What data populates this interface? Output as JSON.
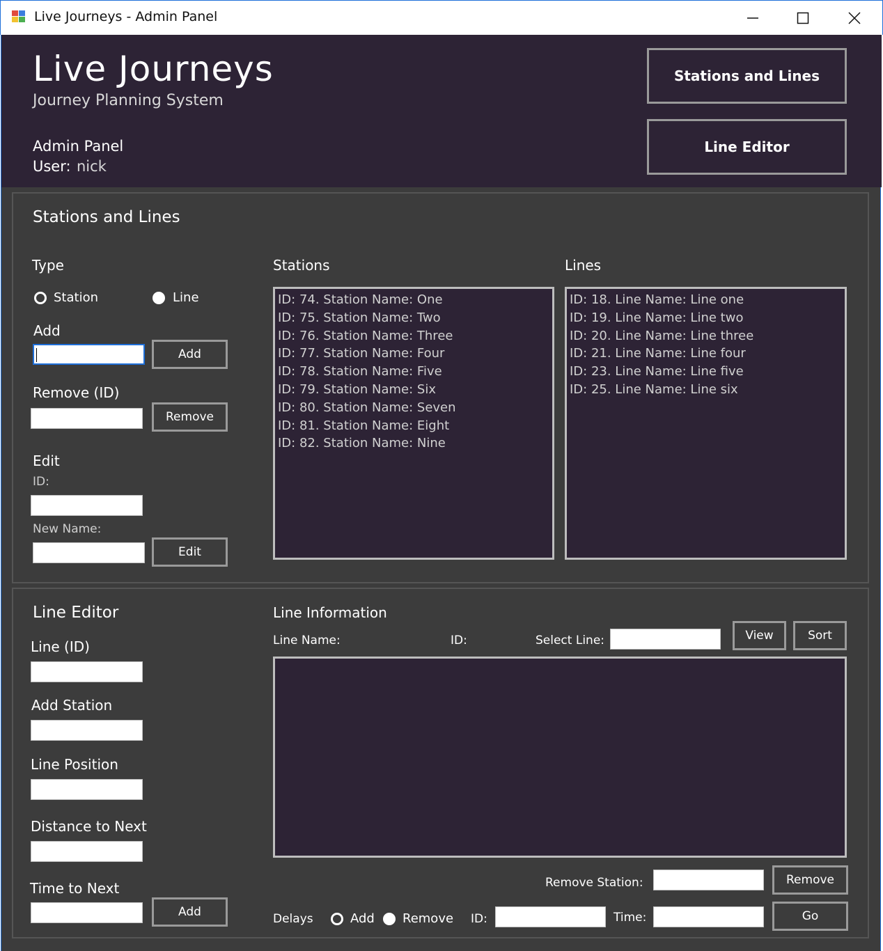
{
  "window": {
    "title": "Live Journeys - Admin Panel",
    "controls": [
      "minimize",
      "maximize",
      "close"
    ]
  },
  "header": {
    "title": "Live Journeys",
    "subtitle": "Journey Planning System",
    "admin_label": "Admin Panel",
    "user_label": "User:",
    "user_name": "nick",
    "nav": {
      "stations_lines": "Stations and Lines",
      "line_editor": "Line Editor"
    }
  },
  "stations_lines": {
    "title": "Stations and Lines",
    "type_label": "Type",
    "radio_station": "Station",
    "radio_line": "Line",
    "add_label": "Add",
    "add_button": "Add",
    "remove_label": "Remove (ID)",
    "remove_button": "Remove",
    "edit_label": "Edit",
    "edit_id_label": "ID:",
    "edit_new_name_label": "New Name:",
    "edit_button": "Edit",
    "stations_header": "Stations",
    "lines_header": "Lines",
    "stations": [
      "ID: 74. Station Name: One",
      "ID: 75. Station Name: Two",
      "ID: 76. Station Name: Three",
      "ID: 77. Station Name: Four",
      "ID: 78. Station Name: Five",
      "ID: 79. Station Name: Six",
      "ID: 80. Station Name: Seven",
      "ID: 81. Station Name: Eight",
      "ID: 82. Station Name: Nine"
    ],
    "lines": [
      "ID: 18. Line Name: Line one",
      "ID: 19. Line Name: Line two",
      "ID: 20. Line Name: Line three",
      "ID: 21. Line Name: Line four",
      "ID: 23. Line Name: Line five",
      "ID: 25. Line Name: Line six"
    ]
  },
  "line_editor": {
    "title": "Line Editor",
    "line_id_label": "Line (ID)",
    "add_station_label": "Add Station",
    "line_position_label": "Line Position",
    "distance_label": "Distance to Next",
    "time_label": "Time to Next",
    "add_button": "Add",
    "info_title": "Line Information",
    "line_name_label": "Line Name:",
    "id_label": "ID:",
    "select_line_label": "Select Line:",
    "view_button": "View",
    "sort_button": "Sort",
    "remove_station_label": "Remove Station:",
    "remove_button": "Remove",
    "delays_label": "Delays",
    "delay_add": "Add",
    "delay_remove": "Remove",
    "delay_id_label": "ID:",
    "delay_time_label": "Time:",
    "go_button": "Go"
  },
  "colors": {
    "header_bg": "#2d2335",
    "panel_bg": "#3c3c3c",
    "list_bg": "#2d2335",
    "accent": "#1e6fd9"
  }
}
